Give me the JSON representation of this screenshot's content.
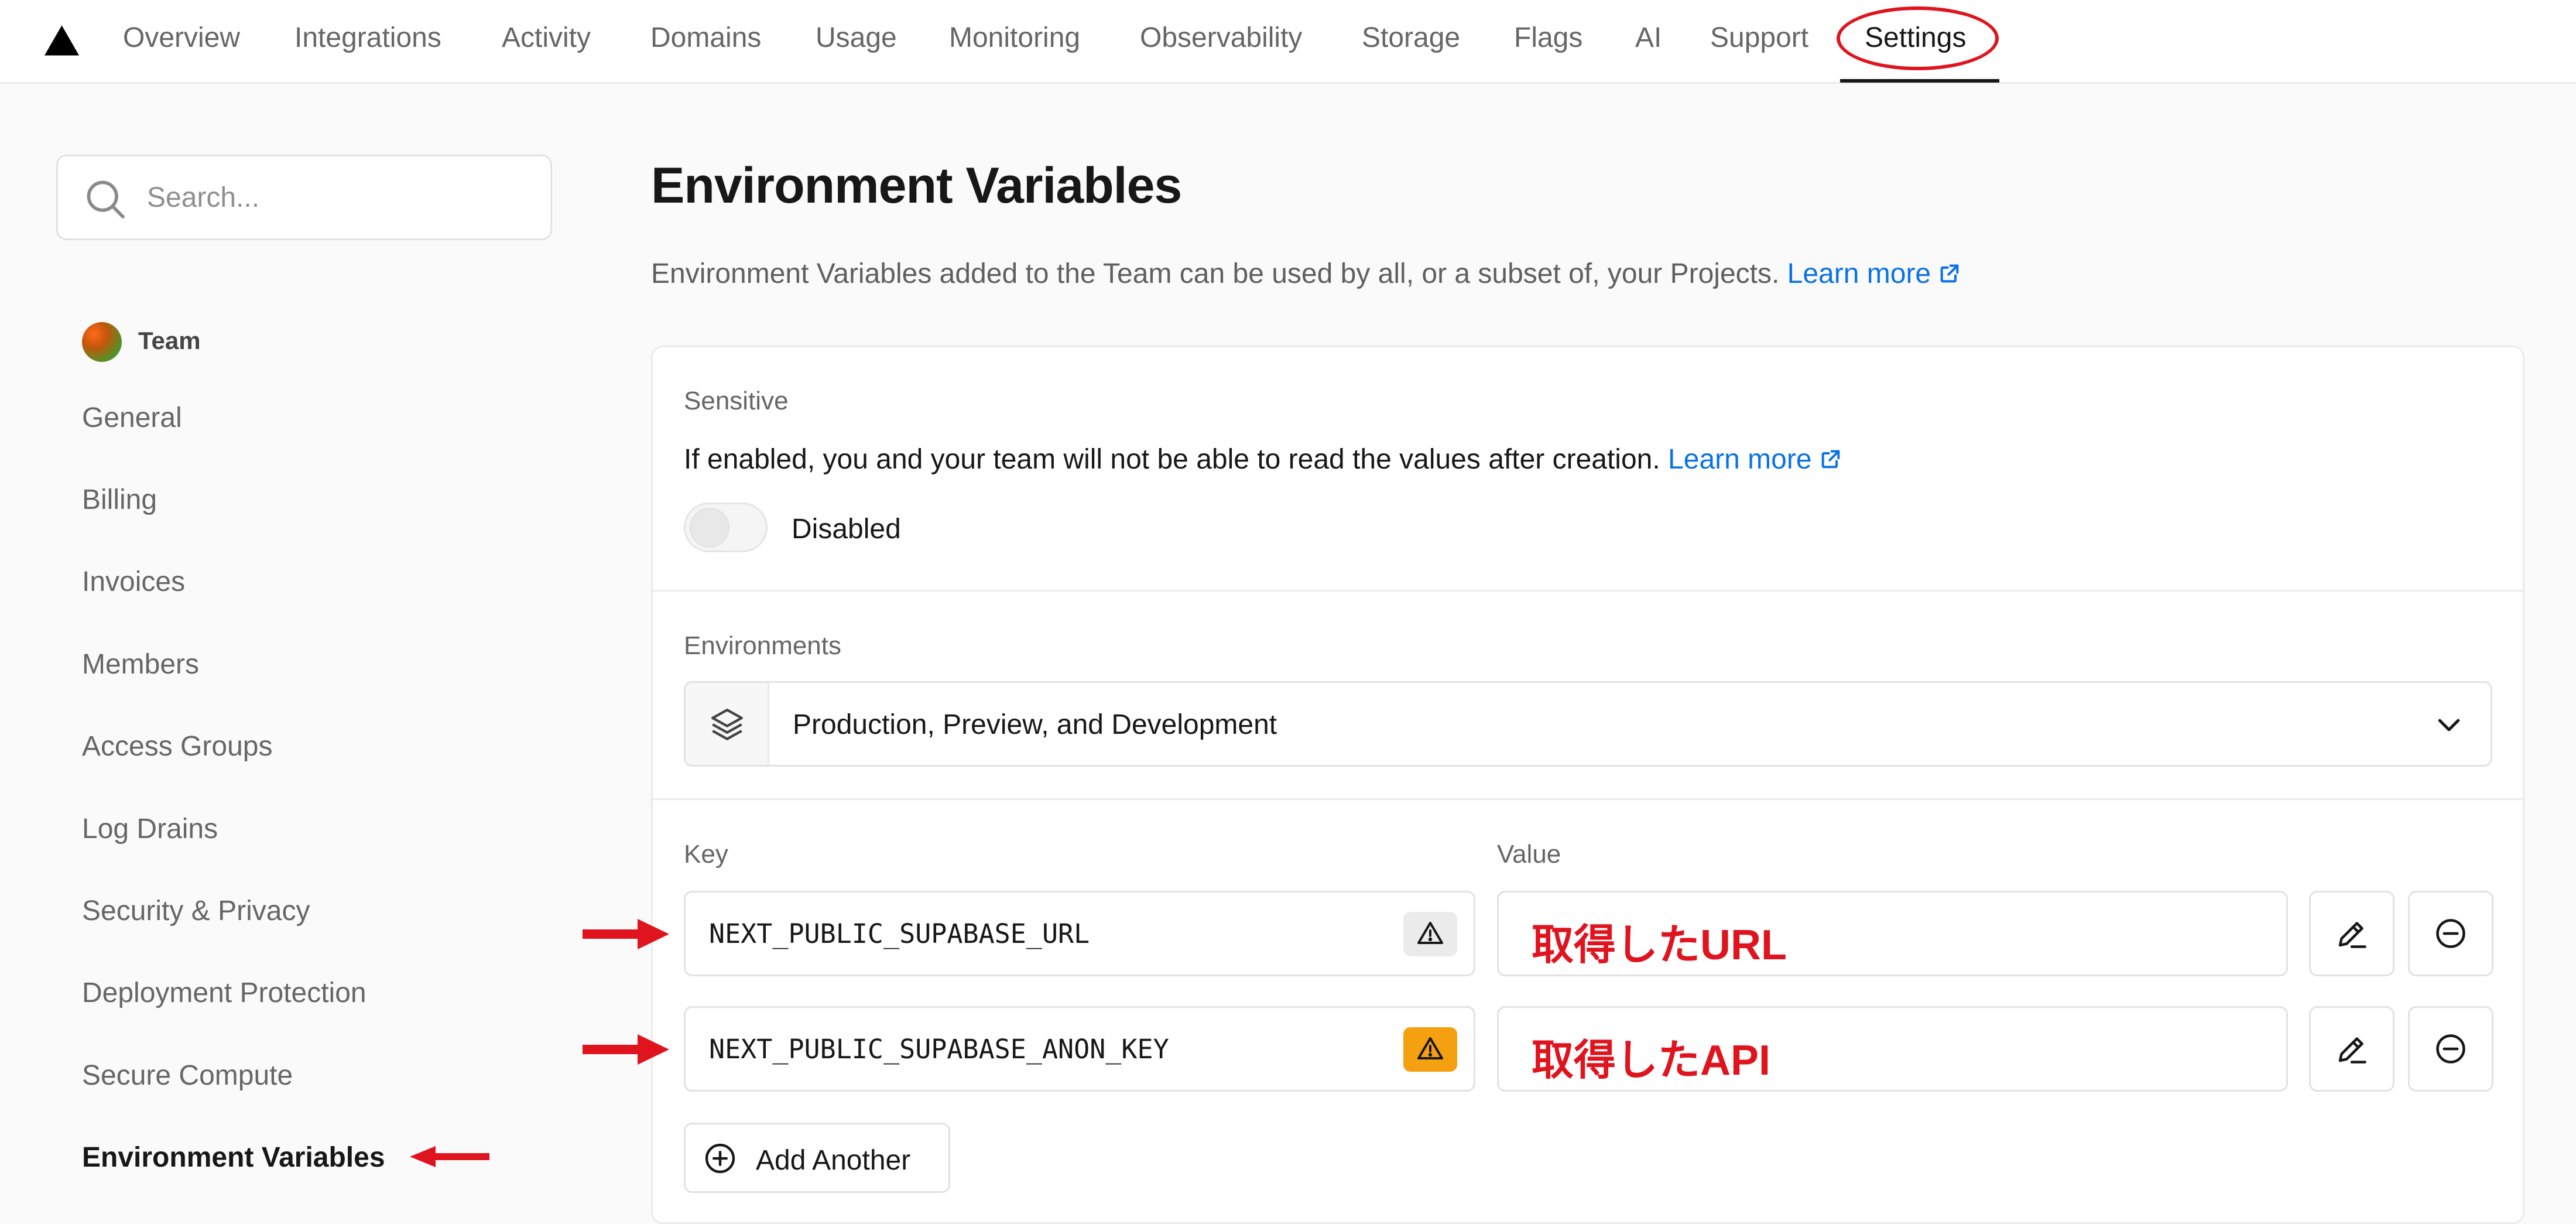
{
  "nav": {
    "items": [
      "Overview",
      "Integrations",
      "Activity",
      "Domains",
      "Usage",
      "Monitoring",
      "Observability",
      "Storage",
      "Flags",
      "AI",
      "Support",
      "Settings"
    ],
    "active": "Settings"
  },
  "sidebar": {
    "search_placeholder": "Search...",
    "team_label": "Team",
    "items": [
      "General",
      "Billing",
      "Invoices",
      "Members",
      "Access Groups",
      "Log Drains",
      "Security & Privacy",
      "Deployment Protection",
      "Secure Compute",
      "Environment Variables"
    ],
    "active": "Environment Variables"
  },
  "main": {
    "title": "Environment Variables",
    "description": "Environment Variables added to the Team can be used by all, or a subset of, your Projects.",
    "learn_more": "Learn more"
  },
  "sensitive": {
    "label": "Sensitive",
    "description": "If enabled, you and your team will not be able to read the values after creation.",
    "learn_more": "Learn more",
    "toggle_state": "Disabled"
  },
  "environments": {
    "label": "Environments",
    "selected": "Production, Preview, and Development"
  },
  "variables": {
    "key_header": "Key",
    "value_header": "Value",
    "rows": [
      {
        "key": "NEXT_PUBLIC_SUPABASE_URL",
        "value": "取得したURL",
        "warning_color": "#ebebeb"
      },
      {
        "key": "NEXT_PUBLIC_SUPABASE_ANON_KEY",
        "value": "取得したAPI",
        "warning_color": "#f5a011"
      }
    ],
    "add_label": "Add Another"
  },
  "colors": {
    "accent_link": "#0a72e8",
    "annotation_red": "#e0141e"
  }
}
